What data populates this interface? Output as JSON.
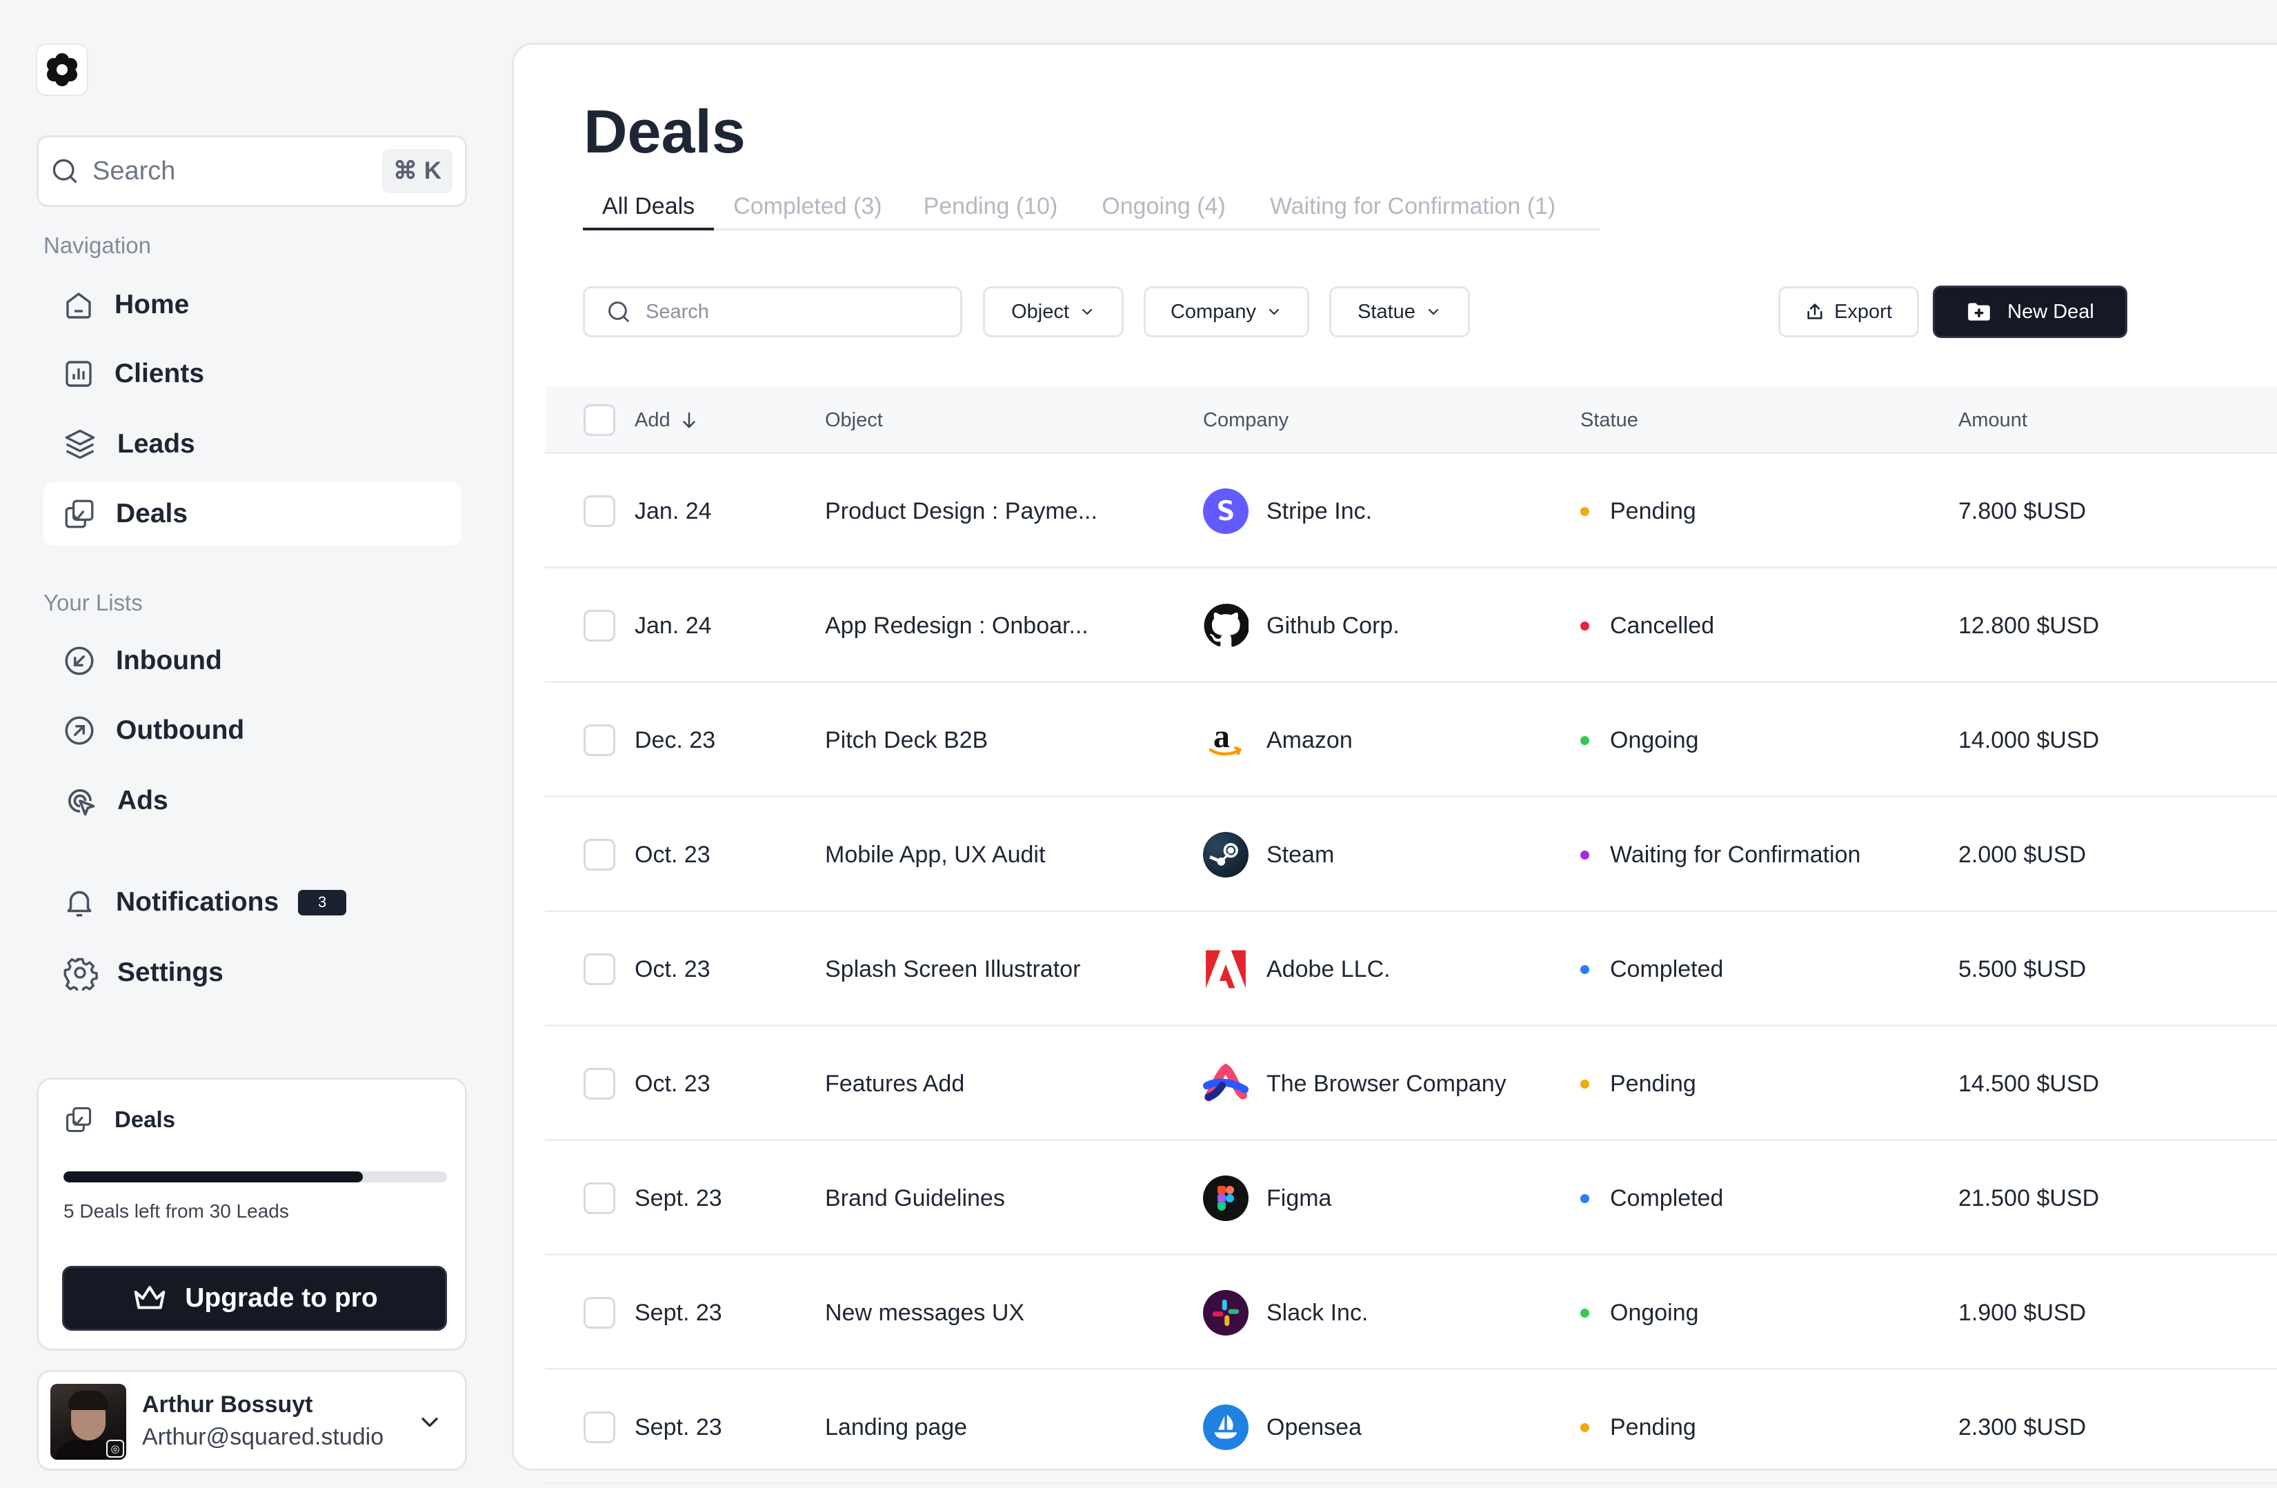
{
  "sidebar": {
    "logo_icon": "flower-logo-icon",
    "search": {
      "placeholder": "Search",
      "shortcut": "⌘ K"
    },
    "navigation_title": "Navigation",
    "nav": [
      {
        "label": "Home",
        "icon": "home-icon"
      },
      {
        "label": "Clients",
        "icon": "bar-chart-icon"
      },
      {
        "label": "Leads",
        "icon": "layers-icon"
      },
      {
        "label": "Deals",
        "icon": "deals-icon",
        "active": true
      }
    ],
    "lists_title": "Your Lists",
    "lists": [
      {
        "label": "Inbound",
        "icon": "arrow-down-left-circle-icon"
      },
      {
        "label": "Outbound",
        "icon": "arrow-up-right-circle-icon"
      },
      {
        "label": "Ads",
        "icon": "cursor-click-icon"
      }
    ],
    "notifications": {
      "label": "Notifications",
      "count": "3"
    },
    "settings": {
      "label": "Settings"
    },
    "deals_card": {
      "title": "Deals",
      "progress_fraction": 0.78,
      "note": "5 Deals left from 30 Leads",
      "upgrade_label": "Upgrade to pro"
    },
    "user": {
      "name": "Arthur Bossuyt",
      "email": "Arthur@squared.studio"
    }
  },
  "main": {
    "title": "Deals",
    "tabs": [
      {
        "label": "All Deals",
        "active": true
      },
      {
        "label": "Completed (3)"
      },
      {
        "label": "Pending (10)"
      },
      {
        "label": "Ongoing (4)"
      },
      {
        "label": "Waiting for Confirmation (1)"
      }
    ],
    "toolbar": {
      "search_placeholder": "Search",
      "filters": [
        "Object",
        "Company",
        "Statue"
      ],
      "export_label": "Export",
      "new_label": "New Deal"
    },
    "table": {
      "headers": {
        "add": "Add",
        "object": "Object",
        "company": "Company",
        "statue": "Statue",
        "amount": "Amount"
      },
      "rows": [
        {
          "date": "Jan. 24",
          "object": "Product Design : Payme...",
          "company": "Stripe Inc.",
          "logo": "stripe",
          "status": "Pending",
          "amount": "7.800 $USD"
        },
        {
          "date": "Jan. 24",
          "object": "App Redesign : Onboar...",
          "company": "Github Corp.",
          "logo": "github",
          "status": "Cancelled",
          "amount": "12.800 $USD"
        },
        {
          "date": "Dec. 23",
          "object": "Pitch Deck B2B",
          "company": "Amazon",
          "logo": "amazon",
          "status": "Ongoing",
          "amount": "14.000 $USD"
        },
        {
          "date": "Oct. 23",
          "object": "Mobile App, UX Audit",
          "company": "Steam",
          "logo": "steam",
          "status": "Waiting for Confirmation",
          "amount": "2.000 $USD"
        },
        {
          "date": "Oct. 23",
          "object": "Splash Screen Illustrator",
          "company": "Adobe LLC.",
          "logo": "adobe",
          "status": "Completed",
          "amount": "5.500 $USD"
        },
        {
          "date": "Oct. 23",
          "object": "Features Add",
          "company": "The Browser Company",
          "logo": "arc",
          "status": "Pending",
          "amount": "14.500 $USD"
        },
        {
          "date": "Sept. 23",
          "object": "Brand Guidelines",
          "company": "Figma",
          "logo": "figma",
          "status": "Completed",
          "amount": "21.500 $USD"
        },
        {
          "date": "Sept. 23",
          "object": "New messages UX",
          "company": "Slack Inc.",
          "logo": "slack",
          "status": "Ongoing",
          "amount": "1.900 $USD"
        },
        {
          "date": "Sept. 23",
          "object": "Landing page",
          "company": "Opensea",
          "logo": "opensea",
          "status": "Pending",
          "amount": "2.300 $USD"
        }
      ]
    },
    "status_colors": {
      "Pending": "#f2a90c",
      "Cancelled": "#e5243b",
      "Ongoing": "#34c759",
      "Waiting for Confirmation": "#a62be0",
      "Completed": "#2e7cf6"
    }
  }
}
